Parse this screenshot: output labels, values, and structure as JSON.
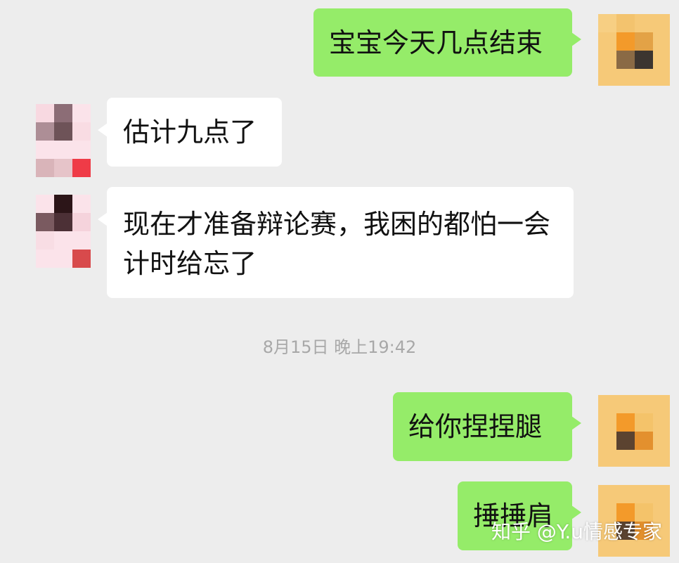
{
  "messages": [
    {
      "sender": "me",
      "text": "宝宝今天几点结束"
    },
    {
      "sender": "them",
      "text": "估计九点了"
    },
    {
      "sender": "them",
      "text": "现在才准备辩论赛，我困的都怕一会计时给忘了"
    },
    {
      "sender": "me",
      "text": "给你捏捏腿"
    },
    {
      "sender": "me",
      "text": "捶捶肩"
    }
  ],
  "timestamp": "8月15日 晚上19:42",
  "watermark": "知乎 @Y.u情感专家",
  "colors": {
    "background": "#ededed",
    "my_bubble": "#95ec69",
    "their_bubble": "#ffffff",
    "timestamp": "#a8a8a8"
  },
  "avatars": {
    "me": "pixelated-orange-avatar",
    "them": "pixelated-pink-avatar"
  }
}
